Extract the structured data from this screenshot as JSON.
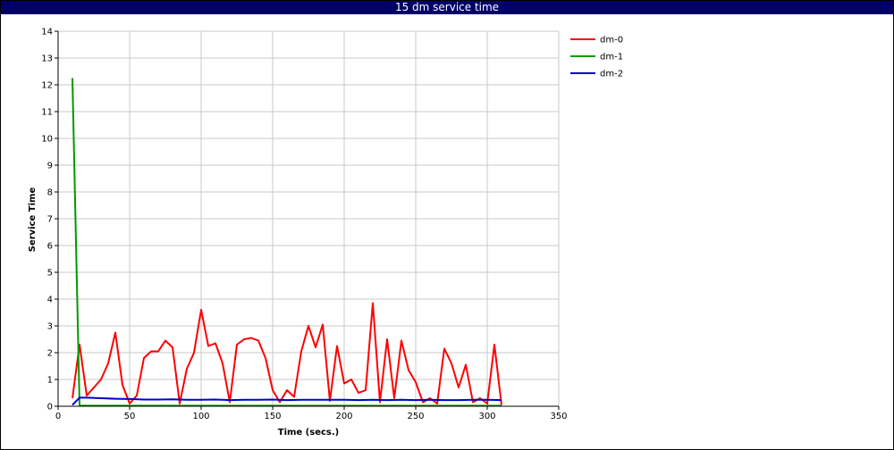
{
  "chart_data": {
    "type": "line",
    "title": "15 dm service time",
    "xlabel": "Time (secs.)",
    "ylabel": "Service Time",
    "xlim": [
      0,
      350
    ],
    "ylim": [
      0,
      14
    ],
    "xticks": [
      0,
      50,
      100,
      150,
      200,
      250,
      300,
      350
    ],
    "yticks": [
      0,
      1,
      2,
      3,
      4,
      5,
      6,
      7,
      8,
      9,
      10,
      11,
      12,
      13,
      14
    ],
    "grid": true,
    "legend_position": "top-right, outside plot",
    "series": [
      {
        "name": "dm-0",
        "color": "#ff0000",
        "x": [
          10,
          15,
          20,
          30,
          35,
          40,
          45,
          50,
          55,
          60,
          65,
          70,
          75,
          80,
          85,
          90,
          95,
          100,
          105,
          110,
          115,
          120,
          125,
          130,
          135,
          140,
          145,
          150,
          155,
          160,
          165,
          170,
          175,
          180,
          185,
          190,
          195,
          200,
          205,
          210,
          215,
          220,
          225,
          230,
          235,
          240,
          245,
          250,
          255,
          260,
          265,
          270,
          275,
          280,
          285,
          290,
          295,
          300,
          305,
          310
        ],
        "y": [
          0.3,
          2.3,
          0.4,
          1.0,
          1.6,
          2.75,
          0.8,
          0.1,
          0.4,
          1.8,
          2.05,
          2.05,
          2.45,
          2.2,
          0.1,
          1.4,
          2.0,
          3.6,
          2.25,
          2.35,
          1.6,
          0.15,
          2.3,
          2.5,
          2.55,
          2.45,
          1.8,
          0.6,
          0.15,
          0.6,
          0.35,
          2.05,
          3.0,
          2.2,
          3.05,
          0.2,
          2.25,
          0.85,
          1.0,
          0.5,
          0.6,
          3.85,
          0.15,
          2.5,
          0.3,
          2.45,
          1.35,
          0.9,
          0.15,
          0.3,
          0.1,
          2.15,
          1.6,
          0.7,
          1.55,
          0.15,
          0.3,
          0.1,
          2.3,
          0.05
        ]
      },
      {
        "name": "dm-1",
        "color": "#009900",
        "x": [
          10,
          15,
          20,
          310
        ],
        "y": [
          12.25,
          0.02,
          0.02,
          0.02
        ]
      },
      {
        "name": "dm-2",
        "color": "#0000cc",
        "x": [
          10,
          15,
          20,
          30,
          40,
          50,
          60,
          70,
          80,
          90,
          100,
          110,
          120,
          130,
          140,
          150,
          160,
          170,
          180,
          190,
          200,
          210,
          220,
          230,
          240,
          250,
          260,
          270,
          280,
          290,
          300,
          310
        ],
        "y": [
          0.05,
          0.32,
          0.32,
          0.3,
          0.28,
          0.27,
          0.25,
          0.25,
          0.26,
          0.24,
          0.24,
          0.25,
          0.23,
          0.24,
          0.24,
          0.25,
          0.23,
          0.24,
          0.24,
          0.24,
          0.24,
          0.23,
          0.24,
          0.23,
          0.24,
          0.23,
          0.24,
          0.23,
          0.23,
          0.24,
          0.24,
          0.23
        ]
      }
    ]
  }
}
